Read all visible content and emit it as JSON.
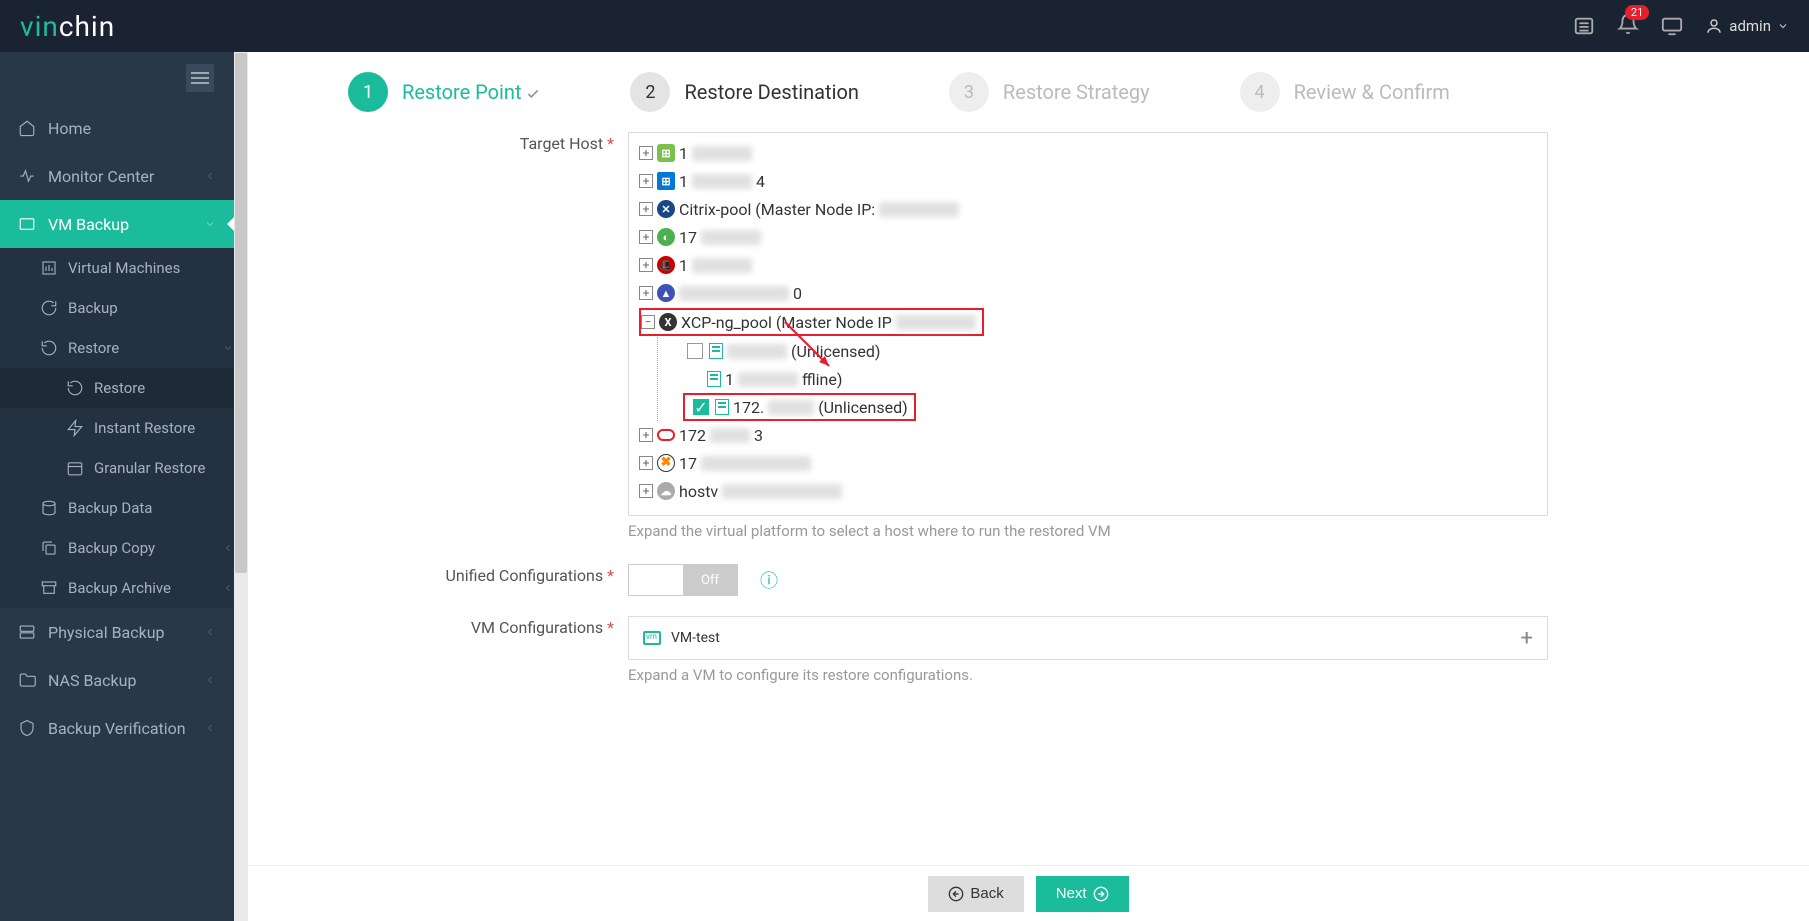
{
  "brand": {
    "part1": "vin",
    "part2": "chin"
  },
  "header": {
    "notif_count": "21",
    "username": "admin"
  },
  "sidebar": {
    "home": "Home",
    "monitor": "Monitor Center",
    "vmbackup": "VM Backup",
    "virtual_machines": "Virtual Machines",
    "backup": "Backup",
    "restore": "Restore",
    "restore_sub": "Restore",
    "instant_restore": "Instant Restore",
    "granular_restore": "Granular Restore",
    "backup_data": "Backup Data",
    "backup_copy": "Backup Copy",
    "backup_archive": "Backup Archive",
    "physical_backup": "Physical Backup",
    "nas_backup": "NAS Backup",
    "backup_verification": "Backup Verification"
  },
  "steps": {
    "s1": "Restore Point",
    "s2": "Restore Destination",
    "s3": "Restore Strategy",
    "s4": "Review & Confirm"
  },
  "form": {
    "target_host": "Target Host",
    "target_hint": "Expand the virtual platform to select a host where to run the restored VM",
    "unified": "Unified Configurations",
    "vm_conf": "VM Configurations",
    "vm_conf_hint": "Expand a VM to configure its restore configurations."
  },
  "tree": {
    "r1": "1",
    "r2_a": "1",
    "r2_b": "4",
    "r3": "Citrix-pool (Master Node IP:",
    "r4": "17",
    "r5": "1",
    "r6_b": "0",
    "r7": "XCP-ng_pool (Master Node IP",
    "child1_suffix": "(Unlicensed)",
    "child2_a": "1",
    "child2_suffix": "ffline)",
    "child3_a": "172.",
    "child3_suffix": "(Unlicensed)",
    "r8_a": "172",
    "r8_b": "3",
    "r9_a": "17",
    "r10": "hostv"
  },
  "toggle": {
    "off": "Off"
  },
  "vm": {
    "name": "VM-test"
  },
  "buttons": {
    "back": "Back",
    "next": "Next"
  }
}
